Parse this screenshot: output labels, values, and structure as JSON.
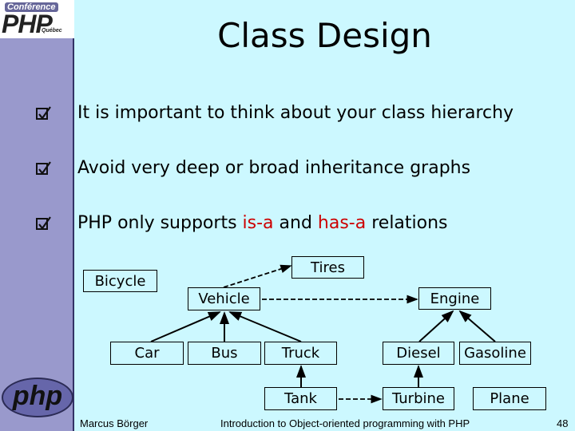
{
  "slide": {
    "title": "Class Design",
    "logos": {
      "top_line1": "Conférence",
      "top_line2": "PHP",
      "top_line3": "Québec",
      "bottom": "php"
    },
    "bullets": [
      {
        "text": "It is important to think about your class hierarchy"
      },
      {
        "text": "Avoid very deep or broad inheritance graphs"
      },
      {
        "prefix": "PHP only supports ",
        "is_a": "is-a",
        "middle": " and ",
        "has_a": "has-a",
        "suffix": " relations"
      }
    ],
    "highlight_color": "#cc0000",
    "diagram": {
      "classes": [
        "Bicycle",
        "Tires",
        "Vehicle",
        "Engine",
        "Car",
        "Bus",
        "Truck",
        "Diesel",
        "Gasoline",
        "Tank",
        "Turbine",
        "Plane"
      ],
      "inheritance": [
        [
          "Car",
          "Vehicle"
        ],
        [
          "Bus",
          "Vehicle"
        ],
        [
          "Truck",
          "Vehicle"
        ],
        [
          "Tank",
          "Truck"
        ],
        [
          "Diesel",
          "Engine"
        ],
        [
          "Gasoline",
          "Engine"
        ],
        [
          "Turbine",
          "Diesel"
        ]
      ],
      "aggregation": [
        [
          "Vehicle",
          "Tires"
        ],
        [
          "Vehicle",
          "Engine"
        ],
        [
          "Tank",
          "Turbine"
        ]
      ]
    },
    "footer": {
      "author": "Marcus Börger",
      "course": "Introduction to Object-oriented programming with PHP",
      "page": "48"
    }
  }
}
